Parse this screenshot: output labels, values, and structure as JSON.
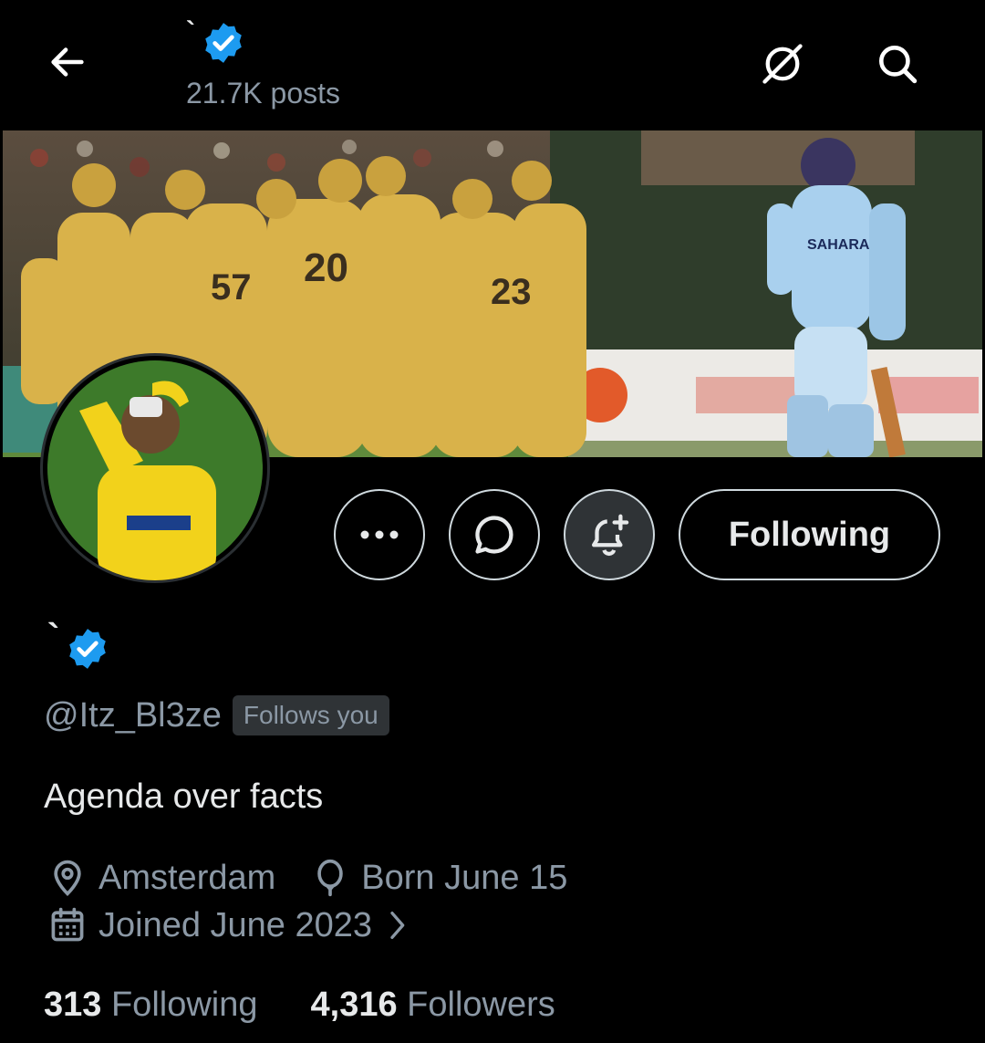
{
  "header": {
    "display_name": "`",
    "posts_count": "21.7K posts"
  },
  "profile": {
    "display_name": "`",
    "handle": "@Itz_Bl3ze",
    "follows_you": "Follows you",
    "bio": "Agenda over facts",
    "location": "Amsterdam",
    "birthday": "Born June 15",
    "joined": "Joined June 2023"
  },
  "actions": {
    "follow_label": "Following"
  },
  "stats": {
    "following_count": "313",
    "following_label": "Following",
    "followers_count": "4,316",
    "followers_label": "Followers"
  },
  "icons": [
    "back-arrow-icon",
    "hide-icon",
    "search-icon",
    "verified-badge-icon",
    "more-icon",
    "message-icon",
    "notify-bell-icon",
    "location-icon",
    "birthday-balloon-icon",
    "calendar-icon",
    "chevron-right-icon"
  ],
  "colors": {
    "background": "#000000",
    "verified": "#1d9bf0",
    "secondary_text": "#8b98a5"
  }
}
